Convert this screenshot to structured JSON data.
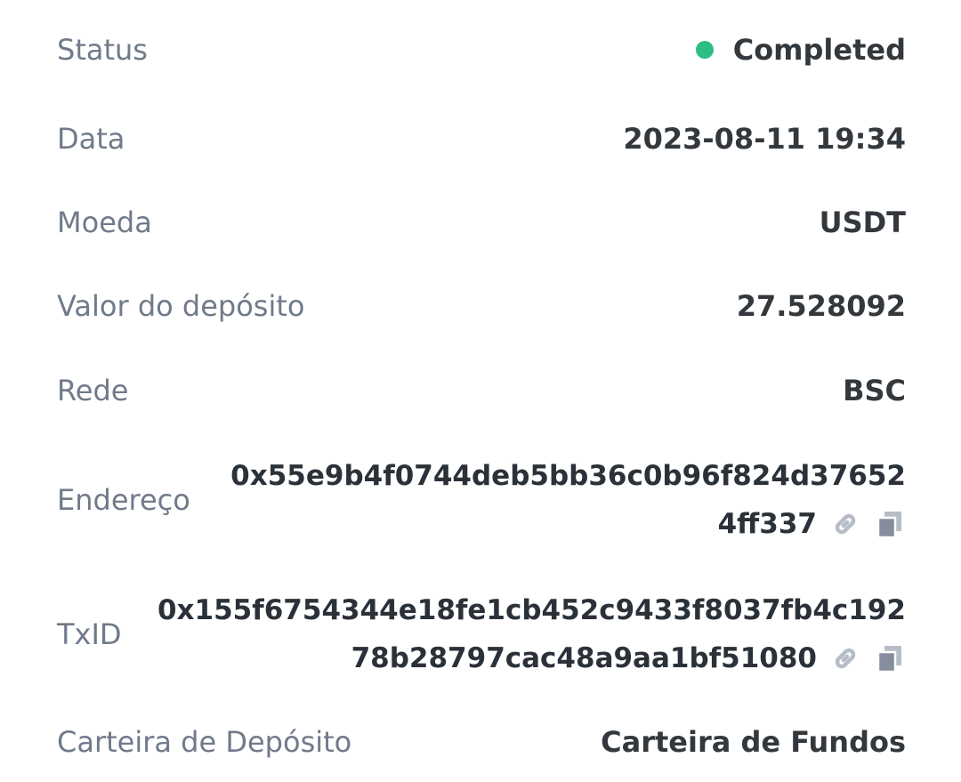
{
  "rows": {
    "status": {
      "label": "Status",
      "value": "Completed",
      "status_color": "#2ebd85"
    },
    "date": {
      "label": "Data",
      "value": "2023-08-11 19:34"
    },
    "coin": {
      "label": "Moeda",
      "value": "USDT"
    },
    "amount": {
      "label": "Valor do depósito",
      "value": "27.528092"
    },
    "network": {
      "label": "Rede",
      "value": "BSC"
    },
    "address": {
      "label": "Endereço",
      "line1": "0x55e9b4f0744deb5bb36c0b96f824d37652",
      "line2": "4ff337"
    },
    "txid": {
      "label": "TxID",
      "line1": "0x155f6754344e18fe1cb452c9433f8037fb4c192",
      "line2": "78b28797cac48a9aa1bf51080"
    },
    "wallet": {
      "label": "Carteira de Depósito",
      "value": "Carteira de Fundos"
    }
  },
  "icons": {
    "link": "link-icon",
    "copy": "copy-icon"
  }
}
